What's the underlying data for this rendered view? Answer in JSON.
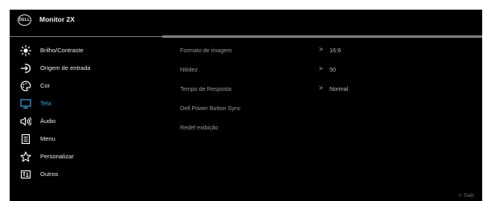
{
  "header": {
    "logo_text": "DELL",
    "title": "Monitor 2X"
  },
  "menu": {
    "items": [
      {
        "label": "Brilho/Contraste",
        "icon": "brightness-icon"
      },
      {
        "label": "Origem de entrada",
        "icon": "input-source-icon"
      },
      {
        "label": "Cor",
        "icon": "color-palette-icon"
      },
      {
        "label": "Tela",
        "icon": "display-icon",
        "active": true
      },
      {
        "label": "Áudio",
        "icon": "speaker-icon"
      },
      {
        "label": "Menu",
        "icon": "menu-list-icon"
      },
      {
        "label": "Personalizar",
        "icon": "star-icon"
      },
      {
        "label": "Outros",
        "icon": "others-icon"
      }
    ]
  },
  "submenu": {
    "items": [
      {
        "label": "Formato de imagem",
        "value": "16:9"
      },
      {
        "label": "Nitidez",
        "value": "50"
      },
      {
        "label": "Tempo de Resposta",
        "value": "Normal"
      },
      {
        "label": "Dell Power Button Sync"
      },
      {
        "label": "Redef exibição"
      }
    ]
  },
  "footer": {
    "exit_label": "< Sair"
  },
  "colors": {
    "background": "#000000",
    "accent": "#3aa3e0",
    "divider": "#7f7f7f",
    "submenu_text": "#9a9a9a"
  }
}
